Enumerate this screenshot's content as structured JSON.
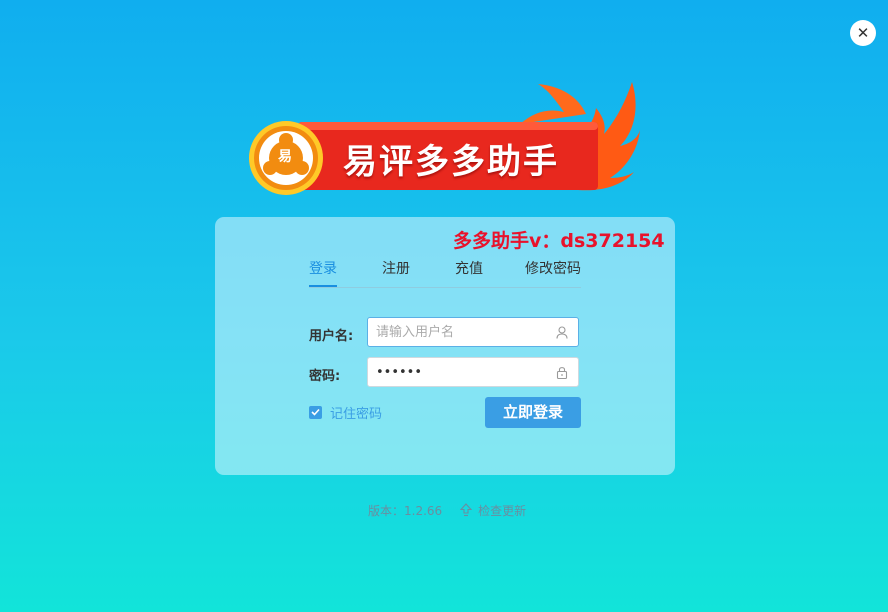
{
  "window": {
    "close_symbol": "✕",
    "close_icon": "close-icon"
  },
  "logo": {
    "title": "易评多多助手",
    "badge_char": "易",
    "colors": {
      "banner": "#e8281e",
      "flame": "#ff5a14",
      "badge": "#f7a51c"
    }
  },
  "watermark": "多多助手v：ds372154",
  "tabs": [
    {
      "label": "登录",
      "active": true
    },
    {
      "label": "注册",
      "active": false
    },
    {
      "label": "充值",
      "active": false
    },
    {
      "label": "修改密码",
      "active": false
    }
  ],
  "form": {
    "username_label": "用户名:",
    "username_placeholder": "请输入用户名",
    "username_value": "",
    "username_icon": "user-icon",
    "password_label": "密码:",
    "password_value": "••••••",
    "password_icon": "lock-icon",
    "remember_label": "记住密码",
    "remember_checked": true,
    "login_label": "立即登录"
  },
  "footer": {
    "version_text": "版本：1.2.66",
    "update_label": "检查更新",
    "update_icon": "upload-arrow-icon"
  },
  "colors": {
    "accent": "#3a9ee4",
    "watermark": "#e8122b"
  }
}
